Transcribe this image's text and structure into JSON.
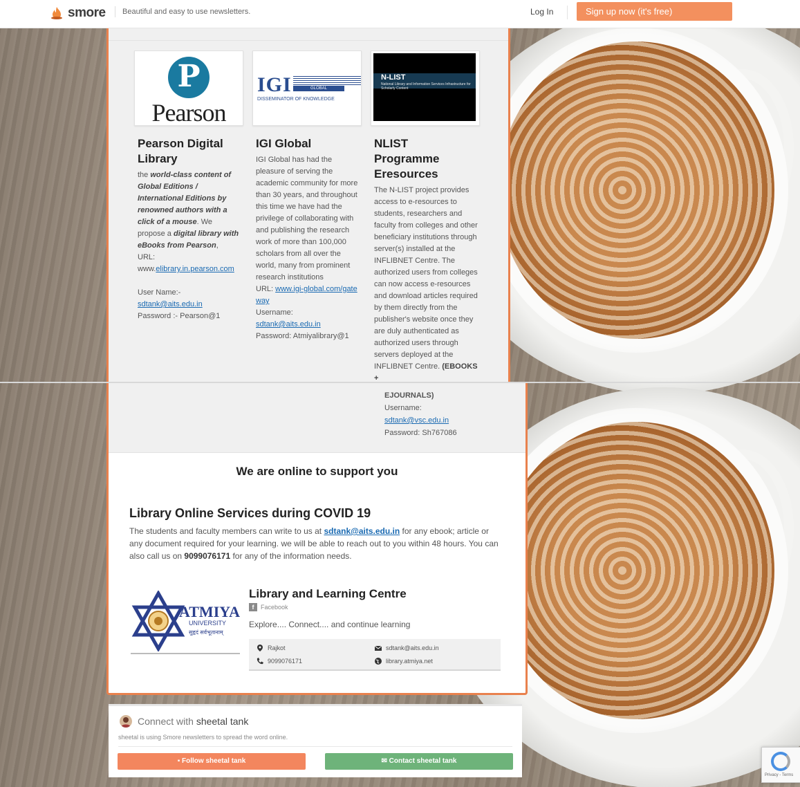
{
  "topbar": {
    "logo_text": "smore",
    "tagline": "Beautiful and easy to use newsletters.",
    "login": "Log In",
    "signup": "Sign up now (it's free)"
  },
  "resources": [
    {
      "title": "Pearson Digital Library",
      "logo_text": "Pearson",
      "desc_pre": "the ",
      "desc_em": "world-class content of Global Editions / International Editions by renowned authors with a click of a mouse",
      "desc_mid": ". We propose a ",
      "desc_em2": "digital library with eBooks from Pearson",
      "desc_post": ",",
      "url_label": "URL:",
      "url_prefix": "www.",
      "url_link": "elibrary.in.pearson.com",
      "user_label": "User Name:-",
      "user_value": "sdtank@aits.edu.in",
      "password": "Password :- Pearson@1"
    },
    {
      "title": "IGI Global",
      "logo_word": "IGI",
      "logo_bar": "GLOBAL",
      "logo_sub": "DISSEMINATOR OF KNOWLEDGE",
      "desc": "IGI Global has had the pleasure of serving the academic community for more than 30 years, and throughout this time we have had the privilege of collaborating with and publishing the research work of more than 100,000 scholars from all over the world, many from prominent research institutions",
      "url_label": "URL: ",
      "url_link": "www.igi-global.com/gateway",
      "user_label": "Username:",
      "user_value": "sdtank@aits.edu.in",
      "password": "Password: Atmiyalibrary@1"
    },
    {
      "title": "NLIST Programme Eresources",
      "logo_title": "N-LIST",
      "logo_sub": "National Library and Information Services Infrastructure for Scholarly Content",
      "desc": "The N-LIST project provides access to e-resources to students, researchers and faculty from colleges and other beneficiary institutions through server(s) installed at the INFLIBNET Centre. The authorized users from colleges can now access e-resources and download articles required by them directly from the publisher's website once they are duly authenticated as authorized users through servers deployed at the INFLIBNET Centre.",
      "desc_bold": "(EBOOKS +",
      "overflow_bold": "EJOURNALS)",
      "user_label": "Username:",
      "user_value": "sdtank@vsc.edu.in",
      "password": "Password: Sh767086"
    }
  ],
  "support": {
    "heading": "We are online to support you",
    "covid_heading": "Library Online Services during COVID 19",
    "p_pre": "The students and faculty members can write to us at ",
    "p_email": "sdtank@aits.edu.in",
    "p_mid": " for any ebook; article or any document required for your learning. we will be able to reach out to you within 48 hours. You can also call us on ",
    "p_phone": "9099076171",
    "p_post": " for any of the information needs."
  },
  "org": {
    "logo_name": "ATMIYA",
    "logo_sub": "UNIVERSITY",
    "logo_motto": "सुहृदं सर्वभूतानाम्",
    "name": "Library and Learning Centre",
    "facebook": "Facebook",
    "tagline": "Explore.... Connect.... and continue learning",
    "location": "Rajkot",
    "phone": "9099076171",
    "email": "sdtank@aits.edu.in",
    "website": "library.atmiya.net"
  },
  "connect": {
    "prefix": "Connect with ",
    "name": "sheetal tank",
    "sub": "sheetal is using Smore newsletters to spread the word online.",
    "follow": "Follow sheetal tank",
    "contact": "Contact sheetal tank"
  },
  "recaptcha": {
    "footer": "Privacy - Terms"
  },
  "colors": {
    "accent": "#e9814d",
    "signup": "#f3905e",
    "follow": "#f3865e",
    "contact": "#6eb37a",
    "link": "#1a6ab2"
  }
}
